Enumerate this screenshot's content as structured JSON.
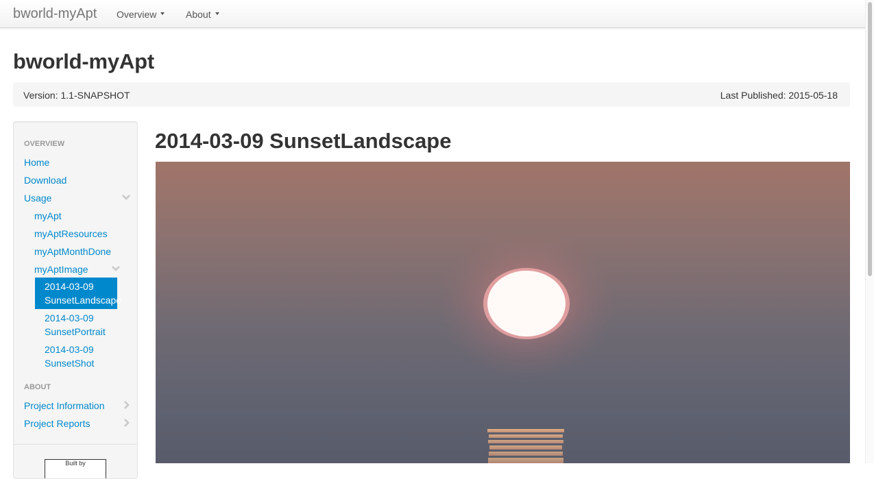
{
  "navbar": {
    "brand": "bworld-myApt",
    "menus": [
      {
        "label": "Overview"
      },
      {
        "label": "About"
      }
    ]
  },
  "header": {
    "title": "bworld-myApt",
    "version": "Version: 1.1-SNAPSHOT",
    "published": "Last Published: 2015-05-18"
  },
  "sidebar": {
    "overview_header": "OVERVIEW",
    "about_header": "ABOUT",
    "home": "Home",
    "download": "Download",
    "usage": "Usage",
    "myApt": "myApt",
    "myAptResources": "myAptResources",
    "myAptMonthDone": "myAptMonthDone",
    "myAptImage": "myAptImage",
    "images": [
      {
        "line1": "2014-03-09",
        "line2": "SunsetLandscape",
        "active": true
      },
      {
        "line1": "2014-03-09",
        "line2": "SunsetPortrait",
        "active": false
      },
      {
        "line1": "2014-03-09",
        "line2": "SunsetShot",
        "active": false
      }
    ],
    "project_information": "Project Information",
    "project_reports": "Project Reports",
    "badge_text": "Built by"
  },
  "main": {
    "title": "2014-03-09 SunsetLandscape"
  },
  "colors": {
    "link": "#0088cc",
    "active_bg": "#0088cc",
    "sidebar_bg": "#f5f5f5"
  },
  "icons": {
    "collapse": "chevron-down-icon",
    "expand": "chevron-right-icon"
  }
}
